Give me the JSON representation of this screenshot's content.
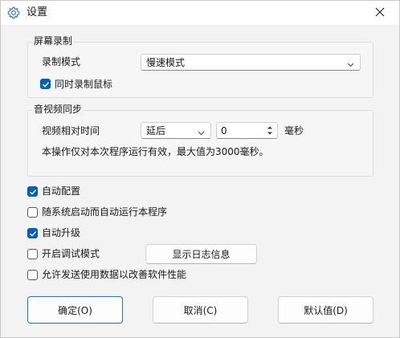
{
  "window": {
    "title": "设置",
    "title_icon": "gear-icon",
    "close_icon": "close-icon"
  },
  "screen_record": {
    "group_title": "屏幕录制",
    "mode_label": "录制模式",
    "mode_value": "慢速模式",
    "record_mouse_label": "同时录制鼠标",
    "record_mouse_checked": true
  },
  "av_sync": {
    "group_title": "音视频同步",
    "offset_label": "视频相对时间",
    "direction_value": "延后",
    "offset_value": "0",
    "unit": "毫秒",
    "note": "本操作仅对本次程序运行有效，最大值为3000毫秒。"
  },
  "options": [
    {
      "label": "自动配置",
      "checked": true
    },
    {
      "label": "随系统启动而自动运行本程序",
      "checked": false
    },
    {
      "label": "自动升级",
      "checked": true
    },
    {
      "label": "开启调试模式",
      "checked": false
    },
    {
      "label": "允许发送使用数据以改善软件性能",
      "checked": false
    }
  ],
  "show_log_button": "显示日志信息",
  "footer": {
    "ok": "确定(O)",
    "cancel": "取消(C)",
    "default": "默认值(D)"
  },
  "colors": {
    "accent": "#005fb8"
  }
}
